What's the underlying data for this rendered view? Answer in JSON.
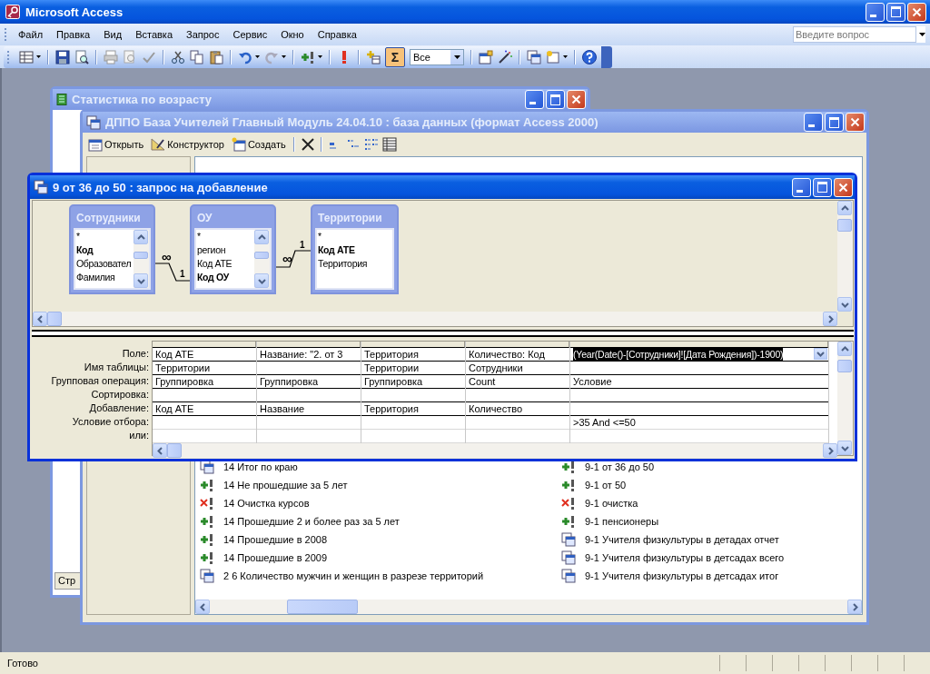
{
  "app": {
    "title": "Microsoft Access"
  },
  "menu": [
    "Файл",
    "Правка",
    "Вид",
    "Вставка",
    "Запрос",
    "Сервис",
    "Окно",
    "Справка"
  ],
  "help_search": {
    "placeholder": "Введите вопрос"
  },
  "toolbar": {
    "totals_button": {
      "label": "Σ",
      "selected": true
    },
    "top_values": "Все"
  },
  "report_window": {
    "title": "Статистика по возрасту",
    "page_tab": "Стр"
  },
  "database_window": {
    "title": "ДППО База Учителей Главный Модуль 24.04.10 : база данных (формат Access 2000)",
    "toolbar": [
      {
        "label": "Открыть",
        "kind": "open"
      },
      {
        "label": "Конструктор",
        "kind": "design"
      },
      {
        "label": "Создать",
        "kind": "new"
      }
    ],
    "object_columns": [
      {
        "items": [
          {
            "name": "14 Итог по краю",
            "kind": "select"
          },
          {
            "name": "14 Не прошедшие за 5 лет",
            "kind": "append"
          },
          {
            "name": "14 Очистка курсов",
            "kind": "delete"
          },
          {
            "name": "14 Прошедшие 2 и более раз за 5 лет",
            "kind": "append"
          },
          {
            "name": "14 Прошедшие в 2008",
            "kind": "append"
          },
          {
            "name": "14 Прошедшие в 2009",
            "kind": "append"
          },
          {
            "name": "2 6 Количество мужчин и женщин в разрезе территорий",
            "kind": "select"
          }
        ]
      },
      {
        "items": [
          {
            "name": "9-1 от 36 до 50",
            "kind": "append"
          },
          {
            "name": "9-1 от 50",
            "kind": "append"
          },
          {
            "name": "9-1 очистка",
            "kind": "delete"
          },
          {
            "name": "9-1 пенсионеры",
            "kind": "append"
          },
          {
            "name": "9-1 Учителя физкультуры в детадах отчет",
            "kind": "select"
          },
          {
            "name": "9-1 Учителя физкультуры в детсадах всего",
            "kind": "select"
          },
          {
            "name": "9-1 Учителя физкультуры в детсадах итог",
            "kind": "select"
          }
        ]
      }
    ]
  },
  "query_window": {
    "title": "9 от 36 до 50 : запрос на добавление",
    "tables": [
      {
        "name": "Сотрудники",
        "scrollable": true,
        "fields": [
          {
            "name": "*",
            "key": false
          },
          {
            "name": "Код",
            "key": true
          },
          {
            "name": "Образовател",
            "key": false
          },
          {
            "name": "Фамилия",
            "key": false
          }
        ]
      },
      {
        "name": "ОУ",
        "scrollable": true,
        "fields": [
          {
            "name": "*",
            "key": false
          },
          {
            "name": "регион",
            "key": false
          },
          {
            "name": "Код АТЕ",
            "key": false
          },
          {
            "name": "Код ОУ",
            "key": true
          }
        ]
      },
      {
        "name": "Территории",
        "scrollable": false,
        "fields": [
          {
            "name": "*",
            "key": false
          },
          {
            "name": "Код АТЕ",
            "key": true
          },
          {
            "name": "Территория",
            "key": false
          }
        ]
      }
    ],
    "joins": [
      {
        "many": "∞",
        "one": "1"
      },
      {
        "many": "∞",
        "one": "1"
      }
    ],
    "grid": {
      "row_labels": [
        "Поле:",
        "Имя таблицы:",
        "Групповая операция:",
        "Сортировка:",
        "Добавление:",
        "Условие отбора:",
        "или:"
      ],
      "columns": [
        {
          "selected": false,
          "field": "Код АТЕ",
          "table": "Территории",
          "total": "Группировка",
          "append": "Код АТЕ"
        },
        {
          "selected": false,
          "field": "Название: \"2. от 3",
          "total": "Группировка",
          "append": "Название"
        },
        {
          "selected": false,
          "field": "Территория",
          "table": "Территории",
          "total": "Группировка",
          "append": "Территория"
        },
        {
          "selected": false,
          "field": "Количество: Код",
          "table": "Сотрудники",
          "total": "Count",
          "append": "Количество"
        },
        {
          "selected": true,
          "field": "(Year(Date()-[Сотрудники]![Дата Рождения])-1900)",
          "total": "Условие",
          "criteria": ">35 And <=50"
        }
      ]
    }
  },
  "status_bar": {
    "text": "Готово"
  }
}
